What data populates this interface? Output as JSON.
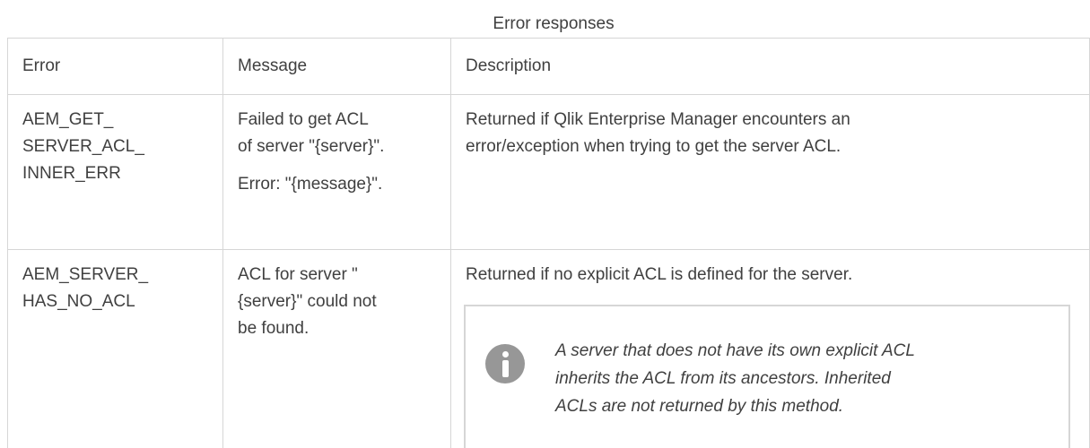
{
  "caption": "Error responses",
  "table": {
    "headers": [
      "Error",
      "Message",
      "Description"
    ],
    "rows": [
      {
        "error": [
          "AEM_GET_",
          "SERVER_ACL_",
          "INNER_ERR"
        ],
        "message": [
          "Failed to get ACL",
          "of server \"{server}\"."
        ],
        "message_extra": "Error: \"{message}\".",
        "description": [
          "Returned if Qlik Enterprise Manager encounters an",
          "error/exception when trying to get the server ACL."
        ]
      },
      {
        "error": [
          "AEM_SERVER_",
          "HAS_NO_ACL"
        ],
        "message": [
          "ACL for server \"",
          "{server}\" could not",
          "be found."
        ],
        "description": [
          "Returned if no explicit ACL is defined for the server."
        ],
        "note": {
          "icon": "info-icon",
          "lines": [
            "A server that does not have its own explicit ACL",
            "inherits the ACL from its ancestors. Inherited",
            "ACLs are not returned by this method."
          ]
        }
      }
    ]
  }
}
